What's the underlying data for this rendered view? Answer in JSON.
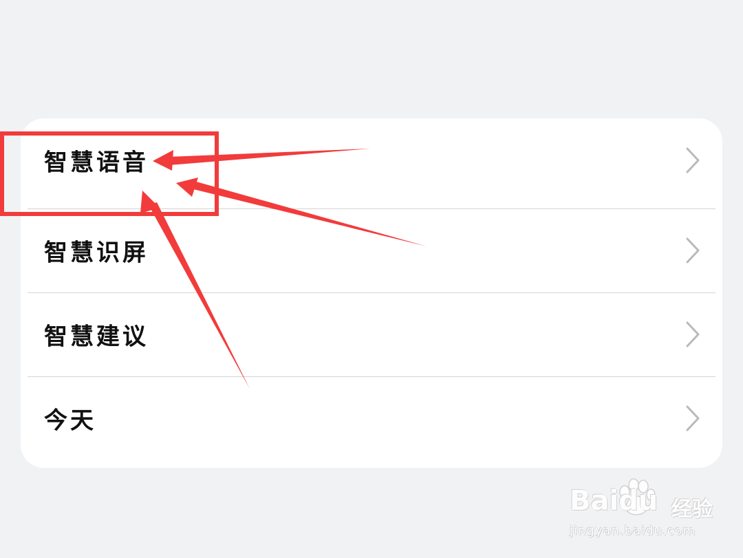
{
  "settings_list": {
    "items": [
      {
        "label": "智慧语音"
      },
      {
        "label": "智慧识屏"
      },
      {
        "label": "智慧建议"
      },
      {
        "label": "今天"
      }
    ]
  },
  "annotation": {
    "highlight_color": "#f23b3b"
  },
  "watermark": {
    "logo_text": "Baidu",
    "product_text": "经验",
    "url_text": "jingyan.baidu.com"
  },
  "colors": {
    "background": "#f1f2f4",
    "card": "#ffffff",
    "text": "#111111",
    "chevron": "#b9b9bd",
    "divider": "#d4d4d6"
  }
}
